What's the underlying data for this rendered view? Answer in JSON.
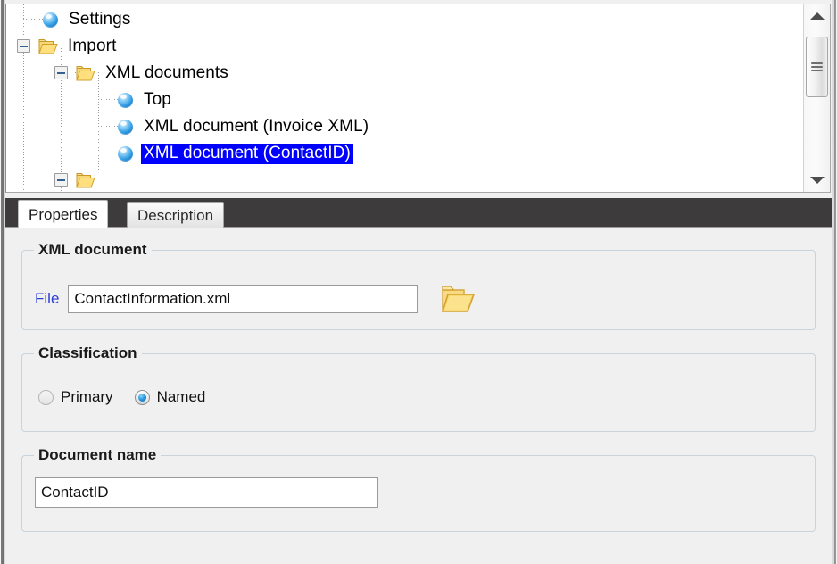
{
  "tree": {
    "name": "configuration-tree",
    "items": [
      {
        "label": "Settings",
        "icon": "sphere-icon",
        "depth": 1,
        "expander": "none",
        "selected": false
      },
      {
        "label": "Import",
        "icon": "folder-icon",
        "depth": 1,
        "expander": "minus",
        "selected": false
      },
      {
        "label": "XML documents",
        "icon": "folder-icon",
        "depth": 2,
        "expander": "minus",
        "selected": false
      },
      {
        "label": "Top",
        "icon": "sphere-icon",
        "depth": 3,
        "expander": "none",
        "selected": false
      },
      {
        "label": "XML document (Invoice XML)",
        "icon": "sphere-icon",
        "depth": 3,
        "expander": "none",
        "selected": false
      },
      {
        "label": "XML document (ContactID)",
        "icon": "sphere-icon",
        "depth": 3,
        "expander": "none",
        "selected": true
      }
    ],
    "selection_color": "#0000ff",
    "selection_text_color": "#ffffff"
  },
  "scrollbar": {
    "up_arrow": "scroll-up-icon",
    "down_arrow": "scroll-down-icon",
    "thumb": "scroll-thumb"
  },
  "tabs": {
    "active": "Properties",
    "inactive": "Description"
  },
  "properties": {
    "xml_document": {
      "title": "XML document",
      "file_label": "File",
      "file_value": "ContactInformation.xml",
      "file_placeholder": "",
      "browse_icon": "folder-open-icon"
    },
    "classification": {
      "title": "Classification",
      "options": [
        {
          "label": "Primary",
          "checked": false
        },
        {
          "label": "Named",
          "checked": true
        }
      ]
    },
    "document_name": {
      "title": "Document name",
      "value": "ContactID",
      "placeholder": ""
    }
  },
  "colors": {
    "accent_link": "#2b3ed0",
    "selection": "#0000ff",
    "tabstrip_bg": "#3d3b3b",
    "panel_bg": "#f0f0f0",
    "groupbox_border": "#c8d3dc"
  }
}
